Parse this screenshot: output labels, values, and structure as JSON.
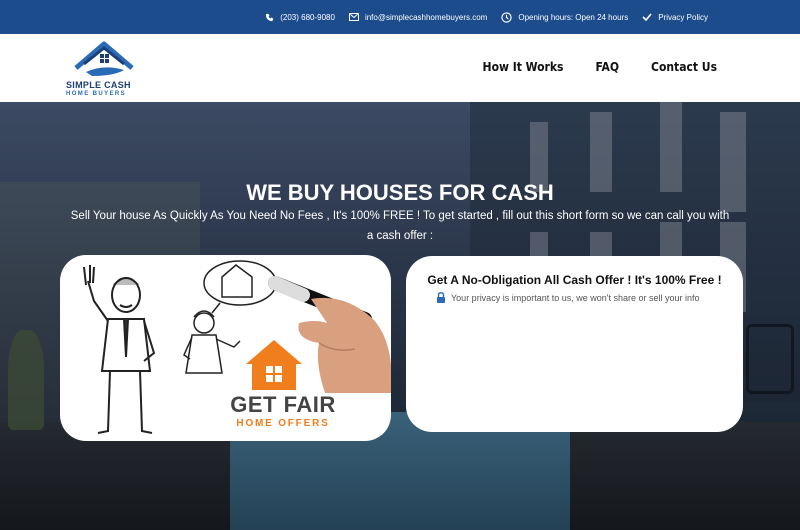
{
  "topbar": {
    "phone": "(203) 680-9080",
    "email": "info@simplecashhomebuyers.com",
    "hours": "Opening hours: Open 24 hours",
    "privacy": "Privacy Policy"
  },
  "logo": {
    "line1": "SIMPLE CASH",
    "line2": "HOME BUYERS"
  },
  "nav": {
    "items": [
      "How It Works",
      "FAQ",
      "Contact Us"
    ]
  },
  "hero": {
    "title": "WE BUY HOUSES FOR CASH",
    "subtitle": "Sell Your house As Quickly As You Need No Fees , It's 100% FREE ! To get started , fill out this short form so we can call you with a cash offer :"
  },
  "video": {
    "brand_line1": "GET FAIR",
    "brand_line2": "HOME OFFERS"
  },
  "form": {
    "title": "Get A No-Obligation All Cash Offer ! It's 100% Free !",
    "privacy": "Your privacy is important to us, we won't share or sell your info"
  },
  "colors": {
    "topbar": "#1c4c8c",
    "brand_orange": "#f07e1c",
    "lock_blue": "#2a6bb8"
  }
}
